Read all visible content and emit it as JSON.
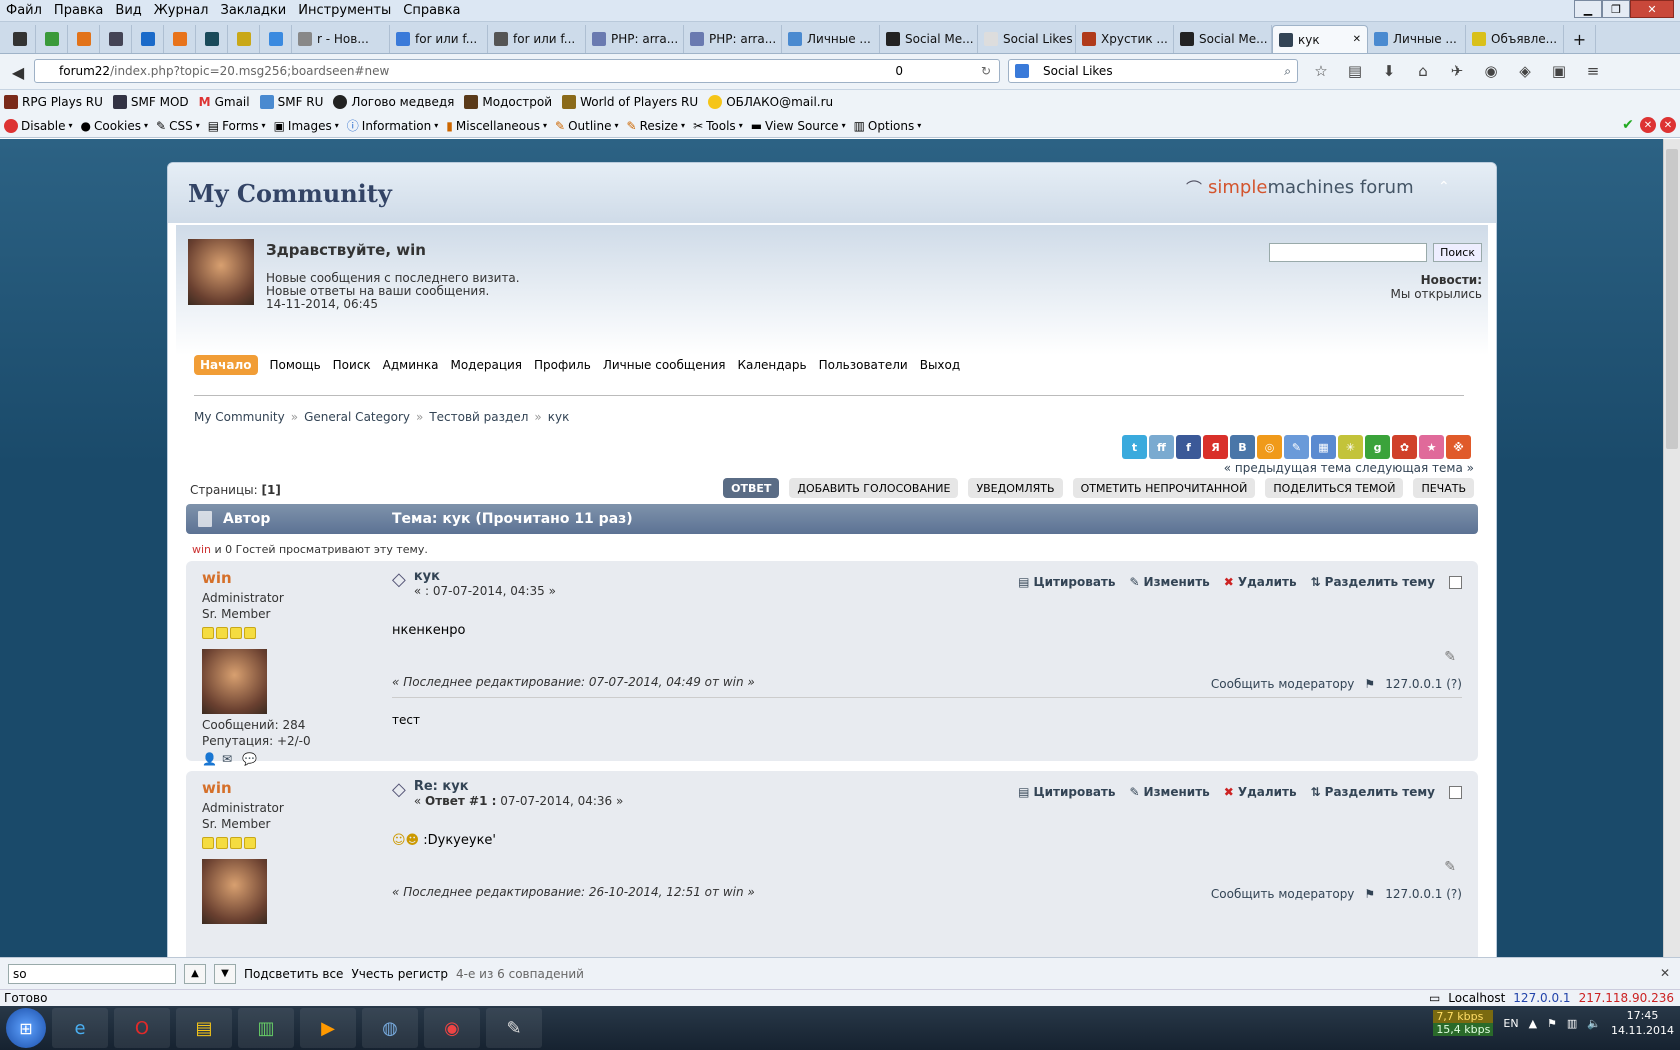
{
  "browser": {
    "menu": [
      "Файл",
      "Правка",
      "Вид",
      "Журнал",
      "Закладки",
      "Инструменты",
      "Справка"
    ],
    "tabs": [
      {
        "label": "",
        "pinned": true,
        "color": "#333"
      },
      {
        "label": "",
        "pinned": true,
        "color": "#3a9a3a"
      },
      {
        "label": "",
        "pinned": true,
        "color": "#e2731a"
      },
      {
        "label": "",
        "pinned": true,
        "color": "#445"
      },
      {
        "label": "",
        "pinned": true,
        "color": "#1a6ac9"
      },
      {
        "label": "",
        "pinned": true,
        "color": "#e8731a"
      },
      {
        "label": "",
        "pinned": true,
        "color": "#1a4a5a"
      },
      {
        "label": "",
        "pinned": true,
        "color": "#c9a818"
      },
      {
        "label": "",
        "pinned": true,
        "color": "#3a8ae0"
      },
      {
        "label": "r - Нов...",
        "pinned": false,
        "color": "#888"
      },
      {
        "label": "for или f...",
        "pinned": false,
        "color": "#3a7ad9"
      },
      {
        "label": "for или f...",
        "pinned": false,
        "color": "#555"
      },
      {
        "label": "PHP: arra...",
        "pinned": false,
        "color": "#6a7ab0"
      },
      {
        "label": "PHP: arra...",
        "pinned": false,
        "color": "#6a7ab0"
      },
      {
        "label": "Личные ...",
        "pinned": false,
        "color": "#4a8ad0"
      },
      {
        "label": "Social Me...",
        "pinned": false,
        "color": "#222"
      },
      {
        "label": "Social Likes ...",
        "pinned": false,
        "color": "#ddd"
      },
      {
        "label": "Хрустик ...",
        "pinned": false,
        "color": "#b03a1a"
      },
      {
        "label": "Social Me...",
        "pinned": false,
        "color": "#222"
      },
      {
        "label": "кук",
        "pinned": false,
        "color": "#345",
        "active": true
      },
      {
        "label": "Личные ...",
        "pinned": false,
        "color": "#4a8ad0"
      },
      {
        "label": "Объявле...",
        "pinned": false,
        "color": "#d9c01a"
      }
    ],
    "url_host": "forum22",
    "url_path": "/index.php?topic=20.msg256;boardseen#new",
    "url_counter": "0",
    "search_value": "Social Likes",
    "bookmarks": [
      "RPG Plays RU",
      "SMF MOD",
      "Gmail",
      "SMF RU",
      "Логово медведя",
      "Модострой",
      "World of Players RU",
      "ОБЛАКО@mail.ru"
    ],
    "devtools": [
      "Disable",
      "Cookies",
      "CSS",
      "Forms",
      "Images",
      "Information",
      "Miscellaneous",
      "Outline",
      "Resize",
      "Tools",
      "View Source",
      "Options"
    ]
  },
  "forum": {
    "title": "My Community",
    "logo_part1": "simple",
    "logo_part2": "machines",
    "logo_part3": "forum",
    "greeting": "Здравствуйте, win",
    "line1": "Новые сообщения с последнего визита.",
    "line2": "Новые ответы на ваши сообщения.",
    "datetime": "14-11-2014, 06:45",
    "search_button": "Поиск",
    "news_label": "Новости:",
    "news_text": "Мы открылись",
    "menu": [
      "Начало",
      "Помощь",
      "Поиск",
      "Админка",
      "Модерация",
      "Профиль",
      "Личные сообщения",
      "Календарь",
      "Пользователи",
      "Выход"
    ],
    "breadcrumb": [
      "My Community",
      "General Category",
      "Тестовй раздел",
      "кук"
    ],
    "share_colors": [
      "#3aaadd",
      "#7aaad0",
      "#3b5998",
      "#d9302a",
      "#4a76a8",
      "#f09a1a",
      "#6a9ad9",
      "#5a8ad0",
      "#c3c33a",
      "#3aa33a",
      "#d0402a",
      "#e06a9a",
      "#e05a2a"
    ],
    "share_labels": [
      "t",
      "ff",
      "f",
      "Я",
      "В",
      "◎",
      "✎",
      "▦",
      "✳",
      "g",
      "✿",
      "★",
      "※"
    ],
    "prev_next": "« предыдущая тема следующая тема »",
    "pages_label": "Страницы:",
    "pages_value": "[1]",
    "buttons": [
      "ОТВЕТ",
      "ДОБАВИТЬ ГОЛОСОВАНИЕ",
      "УВЕДОМЛЯТЬ",
      "ОТМЕТИТЬ НЕПРОЧИТАННОЙ",
      "ПОДЕЛИТЬСЯ ТЕМОЙ",
      "ПЕЧАТЬ"
    ],
    "col_author": "Автор",
    "col_topic": "Тема: кук  (Прочитано 11 раз)",
    "viewers_user": "win",
    "viewers_text": " и 0 Гостей просматривают эту тему.",
    "post_actions": [
      "Цитировать",
      "Изменить",
      "Удалить",
      "Разделить тему"
    ],
    "report": "Сообщить модератору",
    "ip": "127.0.0.1 (?)",
    "posts": [
      {
        "author": "win",
        "role": "Administrator",
        "rank": "Sr. Member",
        "messages": "Сообщений: 284",
        "reputation": "Репутация: +2/-0",
        "subject": "кук",
        "date": "« : 07-07-2014, 04:35 »",
        "body": "нкенкенро",
        "edited": "« Последнее редактирование: 07-07-2014, 04:49 от win »",
        "signature": "тест"
      },
      {
        "author": "win",
        "role": "Administrator",
        "rank": "Sr. Member",
        "subject": "Re: кук",
        "date_prefix": "« ",
        "date_bold": "Ответ #1 :",
        "date_suffix": " 07-07-2014, 04:36 »",
        "body": ":Dукуеуке'",
        "edited": "« Последнее редактирование: 26-10-2014, 12:51 от win »"
      }
    ]
  },
  "findbar": {
    "value": "so",
    "highlight_all": "Подсветить все",
    "match_case": "Учесть регистр",
    "status": "4-е из 6 совпадений"
  },
  "status": {
    "left": "Готово",
    "host": "Localhost",
    "ip_local": "127.0.0.1",
    "ip_ext": "217.118.90.236"
  },
  "taskbar": {
    "speed_down": "7,7 kbps",
    "speed_up": "15,4 kbps",
    "lang": "EN",
    "time": "17:45",
    "date": "14.11.2014"
  }
}
